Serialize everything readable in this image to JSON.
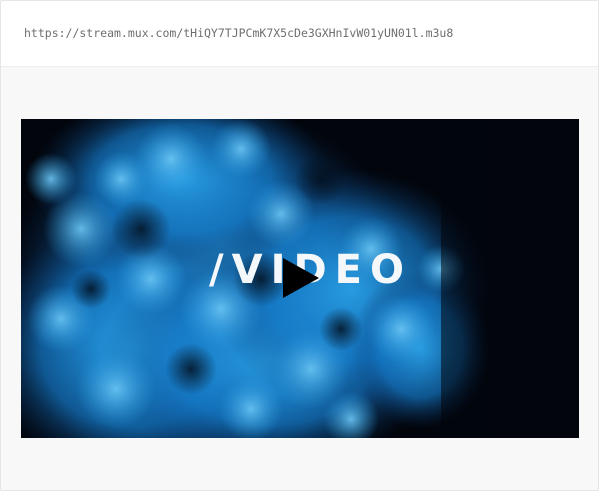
{
  "stream": {
    "url": "https://stream.mux.com/tHiQY7TJPCmK7X5cDe3GXHnIvW01yUN01l.m3u8"
  },
  "player": {
    "poster_title": "/VIDEO",
    "play_icon": "play-icon",
    "poster_colors": {
      "background": "#02050c",
      "ink": "#1f8fd8",
      "ink_light": "#4fb6ee",
      "ink_dark": "#0d3f7a"
    }
  }
}
